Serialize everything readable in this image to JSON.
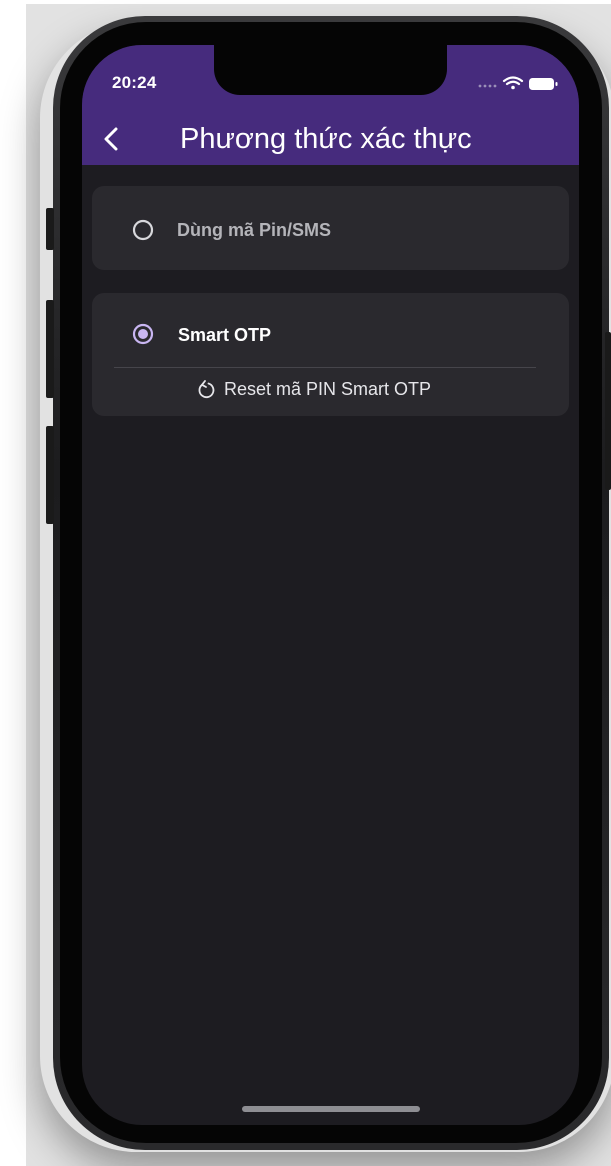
{
  "status_bar": {
    "time": "20:24",
    "icons": [
      "signal-dots-icon",
      "wifi-icon",
      "battery-icon"
    ]
  },
  "header": {
    "back_icon": "chevron-left-icon",
    "title": "Phương thức xác thực"
  },
  "options": [
    {
      "label": "Dùng mã Pin/SMS",
      "selected": false
    },
    {
      "label": "Smart OTP",
      "selected": true,
      "action": {
        "icon": "refresh-icon",
        "label": "Reset mã PIN Smart OTP"
      }
    }
  ],
  "colors": {
    "header_bg": "#462b7d",
    "screen_bg": "#1d1c21",
    "card_bg": "#2a292e",
    "radio_selected": "#c9b6f2"
  }
}
